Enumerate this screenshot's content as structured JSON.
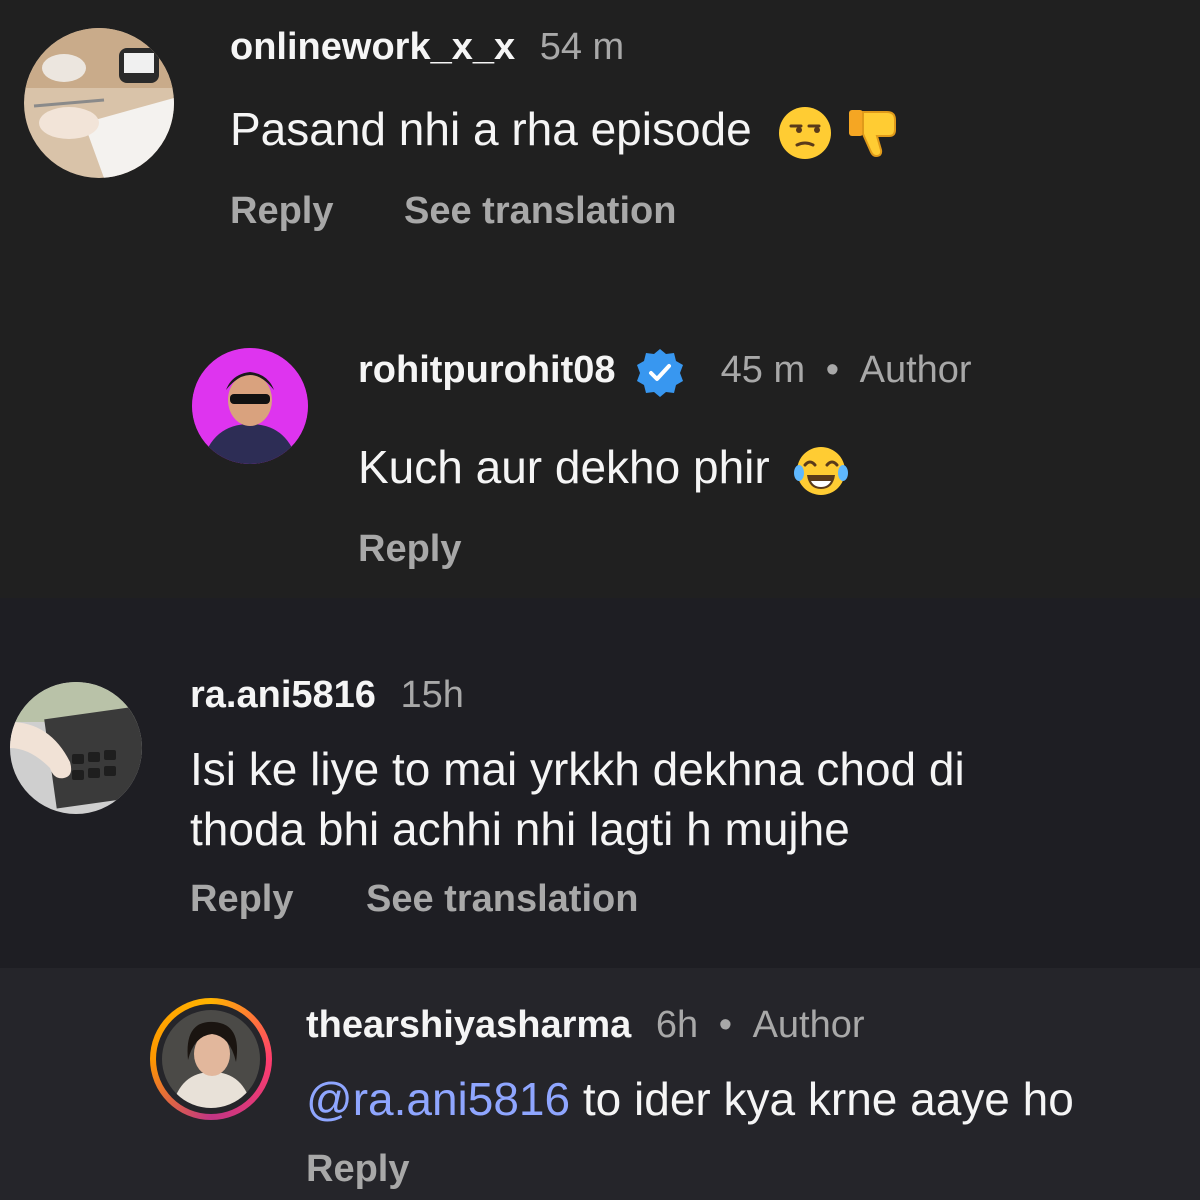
{
  "comments": [
    {
      "username": "onlinework_x_x",
      "time": "54 m",
      "text": "Pasand nhi a rha episode",
      "emojis": [
        "unamused-face",
        "thumbs-down"
      ],
      "reply_label": "Reply",
      "translate_label": "See translation"
    },
    {
      "username": "rohitpurohit08",
      "verified": true,
      "time": "45 m",
      "separator": "•",
      "badge": "Author",
      "text": "Kuch aur dekho phir",
      "emojis": [
        "tears-of-joy-face"
      ],
      "reply_label": "Reply"
    },
    {
      "username": "ra.ani5816",
      "time": "15h",
      "text_line1": "Isi ke liye to mai yrkkh dekhna chod di",
      "text_line2": "thoda bhi achhi nhi lagti h mujhe",
      "reply_label": "Reply",
      "translate_label": "See translation"
    },
    {
      "username": "thearshiyasharma",
      "time": "6h",
      "separator": "•",
      "badge": "Author",
      "mention": "@ra.ani5816",
      "text": " to ider kya krne aaye ho",
      "reply_label": "Reply"
    }
  ],
  "colors": {
    "text_primary": "#f5f5f5",
    "text_secondary": "#a8a8a8",
    "mention": "#8fa6ff",
    "verified": "#3897f0"
  }
}
